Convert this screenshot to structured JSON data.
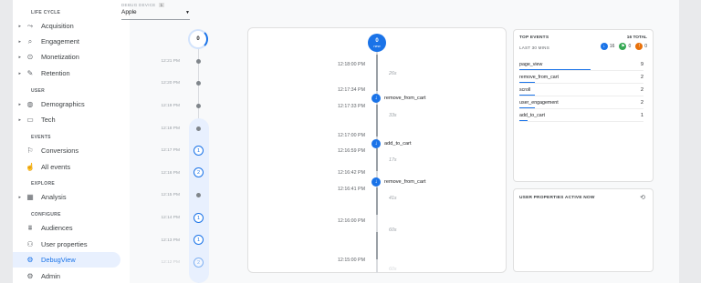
{
  "sidebar": {
    "sections": {
      "life_cycle": "LIFE CYCLE",
      "user": "USER",
      "events": "EVENTS",
      "explore": "EXPLORE",
      "configure": "CONFIGURE"
    },
    "items": {
      "acquisition": "Acquisition",
      "engagement": "Engagement",
      "monetization": "Monetization",
      "retention": "Retention",
      "demographics": "Demographics",
      "tech": "Tech",
      "conversions": "Conversions",
      "all_events": "All events",
      "analysis": "Analysis",
      "audiences": "Audiences",
      "user_properties": "User properties",
      "debugview": "DebugView",
      "admin": "Admin"
    }
  },
  "device": {
    "label": "DEBUG DEVICE",
    "count": "1",
    "selected": "Apple"
  },
  "minutes": {
    "current_count": "0",
    "times": [
      "12:21 PM",
      "12:20 PM",
      "12:19 PM",
      "12:18 PM",
      "12:17 PM",
      "12:16 PM",
      "12:15 PM",
      "12:14 PM",
      "12:13 PM",
      "12:12 PM"
    ],
    "counts": {
      "m1217": "1",
      "m1216": "2",
      "m1214": "1",
      "m1213": "1",
      "m1212": "2"
    }
  },
  "stream": {
    "new_count": "0",
    "new_label": "new",
    "times": {
      "t1": "12:18:00 PM",
      "t2": "12:17:34 PM",
      "t3": "12:17:33 PM",
      "t4": "12:17:00 PM",
      "t5": "12:16:59 PM",
      "t6": "12:16:42 PM",
      "t7": "12:16:41 PM",
      "t8": "12:16:00 PM",
      "t9": "12:15:00 PM"
    },
    "durations": {
      "d1": "26s",
      "d2": "33s",
      "d3": "17s",
      "d4": "41s",
      "d5": "60s",
      "d6": "60s"
    },
    "events": {
      "e1": "remove_from_cart",
      "e2": "add_to_cart",
      "e3": "remove_from_cart"
    }
  },
  "top_events": {
    "title": "TOP EVENTS",
    "total": "16 TOTAL",
    "subtitle": "LAST 30 MINS",
    "badge_blue": "16",
    "badge_green": "0",
    "badge_orange": "0",
    "rows": [
      {
        "name": "page_view",
        "value": "9"
      },
      {
        "name": "remove_from_cart",
        "value": "2"
      },
      {
        "name": "scroll",
        "value": "2"
      },
      {
        "name": "user_engagement",
        "value": "2"
      },
      {
        "name": "add_to_cart",
        "value": "1"
      }
    ]
  },
  "user_props": {
    "title": "USER PROPERTIES ACTIVE NOW"
  },
  "colors": {
    "accent": "#1a73e8",
    "green": "#34a853",
    "orange": "#e8710a"
  }
}
